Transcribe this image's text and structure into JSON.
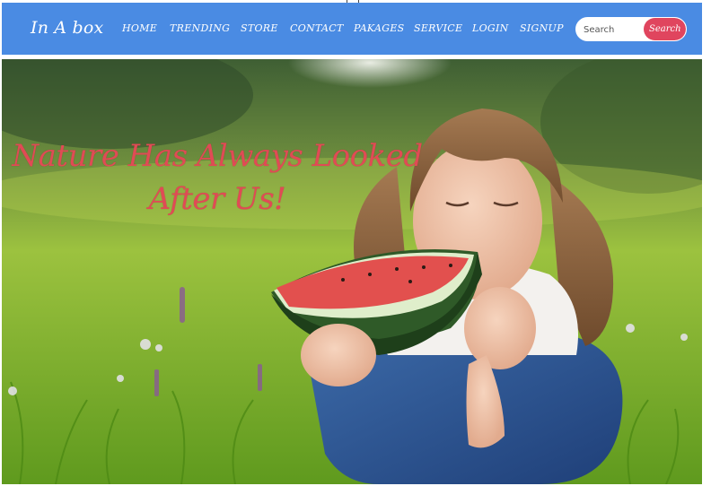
{
  "brand": "In A box",
  "nav": {
    "items": [
      "HOME",
      "TRENDING",
      "STORE",
      "CONTACT",
      "PAKAGES",
      "SERVICE",
      "LOGIN",
      "SIGNUP"
    ]
  },
  "search": {
    "placeholder": "Search",
    "button_label": "Search"
  },
  "hero": {
    "title": "Nature Has Always Looked After Us!",
    "image": "girl-eating-watermelon-in-meadow"
  },
  "colors": {
    "navbar": "#4a8be3",
    "search_button": "#e0455e",
    "hero_title": "#e04b55"
  }
}
